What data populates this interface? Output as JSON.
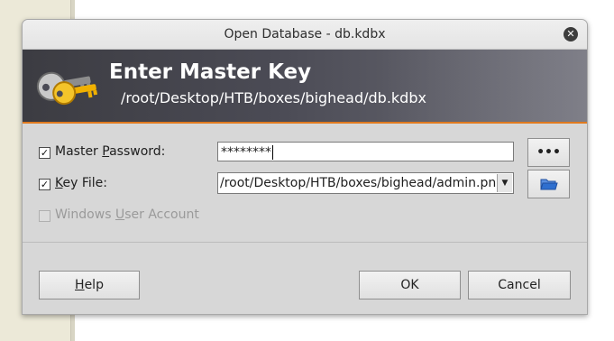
{
  "window": {
    "title": "Open Database - db.kdbx"
  },
  "banner": {
    "title": "Enter Master Key",
    "path": "/root/Desktop/HTB/boxes/bighead/db.kdbx"
  },
  "master_password": {
    "checked": true,
    "label_pre": "Master ",
    "label_ul": "P",
    "label_post": "assword:",
    "value": "********",
    "reveal_label": "•••"
  },
  "key_file": {
    "checked": true,
    "label_ul": "K",
    "label_post": "ey File:",
    "value": "/root/Desktop/HTB/boxes/bighead/admin.png"
  },
  "windows_account": {
    "checked": false,
    "label_pre": "Windows ",
    "label_ul": "U",
    "label_post": "ser Account"
  },
  "buttons": {
    "help_ul": "H",
    "help_post": "elp",
    "ok": "OK",
    "cancel": "Cancel"
  },
  "colors": {
    "banner_accent": "#e07a1f",
    "folder_icon": "#2f6fcf",
    "key_icon": "#f0b000"
  }
}
